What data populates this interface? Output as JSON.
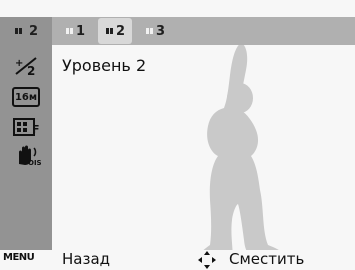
{
  "topbar": {
    "current": "2",
    "options": [
      "1",
      "2",
      "3"
    ],
    "selected_index": 1
  },
  "left_icons": [
    "ev-compensation-icon",
    "resolution-16m-icon",
    "quality-fine-icon",
    "ois-stabilizer-icon"
  ],
  "left_icon_texts": [
    "16м",
    "F",
    "OIS"
  ],
  "main": {
    "setting_value": "Уровень 2"
  },
  "bottom": {
    "menu_key": "MENU",
    "back_label": "Назад",
    "move_label": "Сместить"
  },
  "colors": {
    "panel": "#939393",
    "topbar": "#b0b0b0",
    "background": "#f7f7f7",
    "silhouette": "#c9c9c9"
  }
}
